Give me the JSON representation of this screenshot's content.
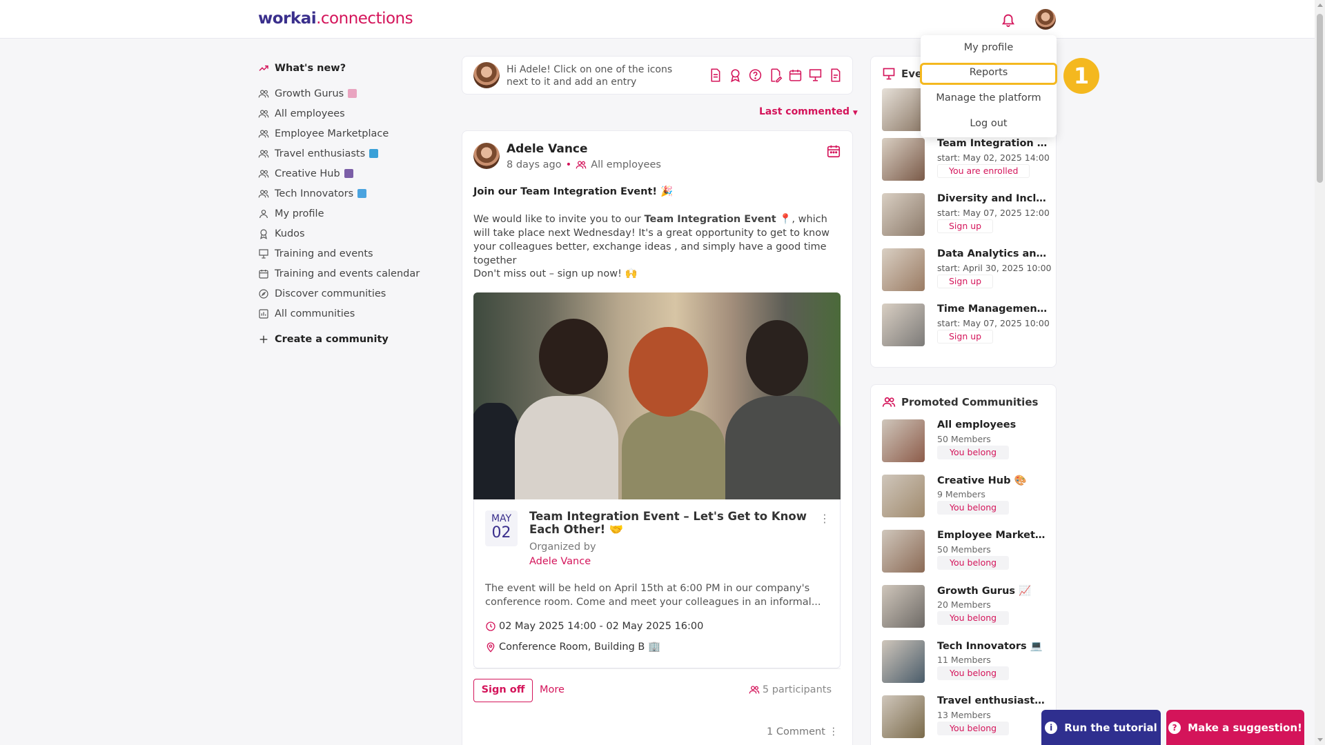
{
  "header": {
    "logo_part1": "workai",
    "logo_part2": ".connections"
  },
  "sidebar": {
    "whats_new": "What's new?",
    "items": [
      {
        "label": "Growth Gurus",
        "icon": "group-icon",
        "emoji": "#e9a4c0"
      },
      {
        "label": "All employees",
        "icon": "group-icon"
      },
      {
        "label": "Employee Marketplace",
        "icon": "group-icon"
      },
      {
        "label": "Travel enthusiasts",
        "icon": "group-icon",
        "emoji": "#3aa0d8"
      },
      {
        "label": "Creative Hub",
        "icon": "group-icon",
        "emoji": "#7b5ea7"
      },
      {
        "label": "Tech Innovators",
        "icon": "group-icon",
        "emoji": "#4aa3df"
      },
      {
        "label": "My profile",
        "icon": "user-icon"
      },
      {
        "label": "Kudos",
        "icon": "award-icon"
      },
      {
        "label": "Training and events",
        "icon": "presentation-icon"
      },
      {
        "label": "Training and events calendar",
        "icon": "calendar-icon"
      },
      {
        "label": "Discover communities",
        "icon": "compass-icon"
      },
      {
        "label": "All communities",
        "icon": "chart-icon"
      }
    ],
    "create": "Create a community"
  },
  "composer": {
    "prompt": "Hi Adele! Click on one of the icons next to it and add an entry"
  },
  "sort_label": "Last commented",
  "post": {
    "author": "Adele Vance",
    "time": "8 days ago",
    "audience": "All employees",
    "headline": "Join our Team Integration Event! 🎉",
    "body_pre": "We would like to invite you to our ",
    "body_bold": "Team Integration Event",
    "body_post": " 📍, which will take place next Wednesday! It's a great opportunity to get to know your colleagues better, exchange ideas , and simply have a good time together",
    "closing": "Don't miss out – sign up now! 🙌",
    "event": {
      "month": "MAY",
      "day": "02",
      "title": "Team Integration Event – Let's Get to Know Each Other! 🤝",
      "organized_by": "Organized by",
      "organizer": "Adele Vance",
      "description": "The event will be held on April 15th at 6:00 PM in our company's conference room. Come and meet your colleagues in an informal...",
      "datetime": "02 May 2025 14:00 - 02 May 2025 16:00",
      "location": "Conference Room, Building B 🏢"
    },
    "sign_off": "Sign off",
    "more": "More",
    "participants": "5 participants",
    "comments": "1 Comment"
  },
  "events_panel": {
    "title": "Events",
    "items": [
      {
        "title": "Team Integration Ev...",
        "start": "start: May 02, 2025 14:00",
        "status": "You are enrolled",
        "thumb": "#7a5a48"
      },
      {
        "title": "Diversity and Inclusi...",
        "start": "start: May 07, 2025 12:00",
        "status": "Sign up",
        "thumb": "#8c7a6a"
      },
      {
        "title": "Data Analytics and ...",
        "start": "start: April 30, 2025 10:00",
        "status": "Sign up",
        "thumb": "#9a7b63"
      },
      {
        "title": "Time Management ...",
        "start": "start: May 07, 2025 10:00",
        "status": "Sign up",
        "thumb": "#7c7a78"
      }
    ]
  },
  "promoted": {
    "title": "Promoted Communities",
    "items": [
      {
        "name": "All employees",
        "members": "50 Members",
        "status": "You belong",
        "thumb": "#8d5c4a"
      },
      {
        "name": "Creative Hub 🎨",
        "members": "9 Members",
        "status": "You belong",
        "thumb": "#a08a6d"
      },
      {
        "name": "Employee Marketpla...",
        "members": "50 Members",
        "status": "You belong",
        "thumb": "#8b6a55"
      },
      {
        "name": "Growth Gurus 📈",
        "members": "20 Members",
        "status": "You belong",
        "thumb": "#6e6a66"
      },
      {
        "name": "Tech Innovators 💻",
        "members": "11 Members",
        "status": "You belong",
        "thumb": "#4a5c6a"
      },
      {
        "name": "Travel enthusiasts ...",
        "members": "13 Members",
        "status": "You belong",
        "thumb": "#7a6a4a"
      }
    ]
  },
  "dropdown": {
    "items": [
      "My profile",
      "Reports",
      "Manage the platform",
      "Log out"
    ],
    "highlighted": "Reports"
  },
  "step_number": "1",
  "bottom": {
    "tutorial": "Run the tutorial",
    "suggestion": "Make a suggestion!"
  },
  "colors": {
    "brand_primary": "#3a2f8c",
    "brand_accent": "#d4145a",
    "highlight": "#f4b81f"
  }
}
